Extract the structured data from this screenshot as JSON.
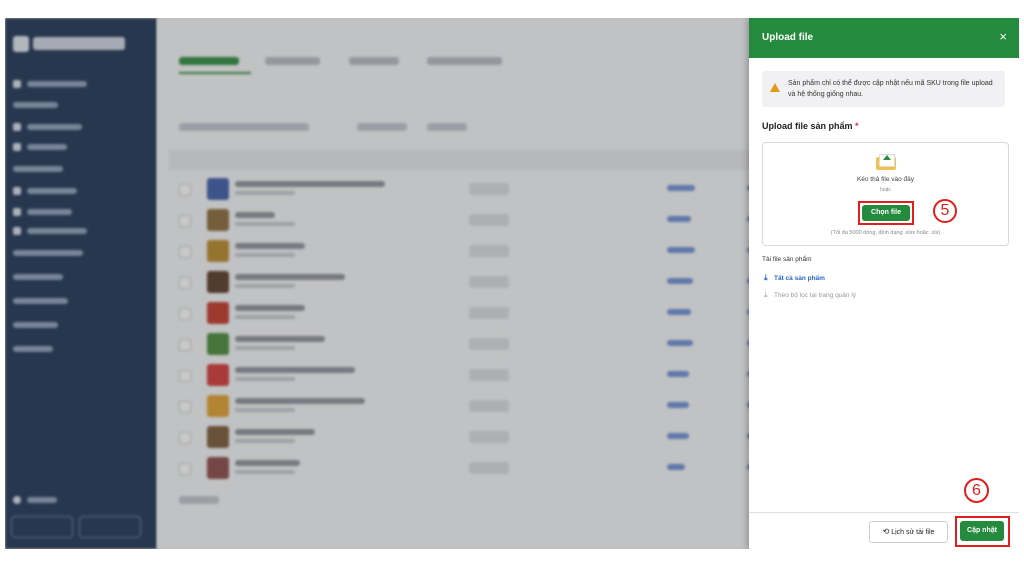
{
  "panel": {
    "title": "Upload file",
    "close": "×",
    "warning": "Sản phẩm chỉ có thể được cập nhật nếu mã SKU trong file upload và hệ thống giống nhau.",
    "section_title": "Upload file sản phẩm",
    "required_mark": "*",
    "drop_text": "Kéo thả file vào đây",
    "or_text": "hoặc",
    "choose_button": "Chọn file",
    "hint": "(Tối đa 5000 dòng, định dạng .xlsx hoặc .xls)",
    "step5": "5",
    "download_label": "Tải file sản phẩm",
    "download_all": "Tất cả sản phẩm",
    "download_filtered": "Theo bộ lọc tại trang quản lý",
    "history_button": "Lịch sử tải file",
    "update_button": "Cập nhật",
    "step6": "6"
  },
  "colors": {
    "primary_green": "#248a3d",
    "highlight_red": "#e21d1d",
    "link_blue": "#2a66c9",
    "sidebar_navy": "#1f3555"
  },
  "icons": {
    "warning": "warning-triangle-icon",
    "upload": "upload-folder-icon",
    "download": "download-icon",
    "history": "history-clock-icon",
    "close": "close-icon"
  }
}
